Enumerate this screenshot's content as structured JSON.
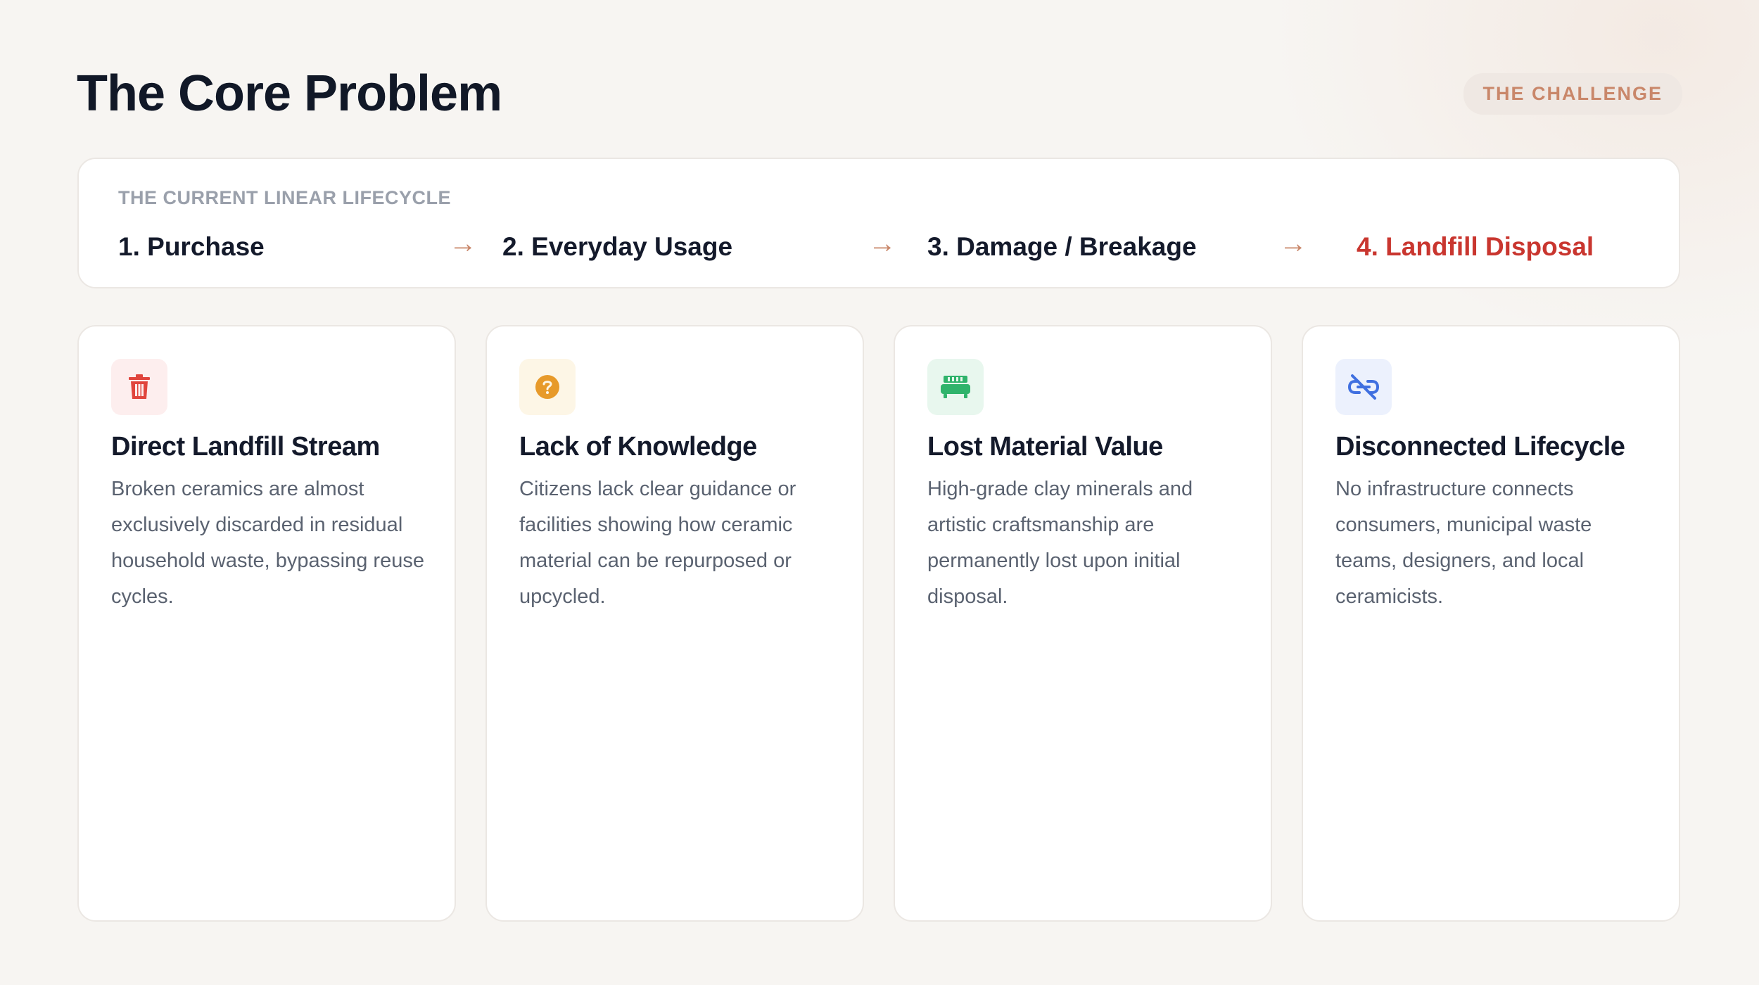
{
  "header": {
    "title": "The Core Problem",
    "badge": "THE CHALLENGE"
  },
  "lifecycle": {
    "label": "THE CURRENT LINEAR LIFECYCLE",
    "steps": [
      {
        "label": "1. Purchase"
      },
      {
        "label": "2. Everyday Usage"
      },
      {
        "label": "3. Damage / Breakage"
      },
      {
        "label": "4. Landfill Disposal"
      }
    ],
    "arrow": "→",
    "colors": {
      "accent": "#c9876a",
      "danger": "#c9362f"
    }
  },
  "cards": [
    {
      "icon": "trash-icon",
      "title": "Direct Landfill Stream",
      "text": "Broken ceramics are almost exclusively discarded in residual household waste, bypassing reuse cycles.",
      "icon_color": "#e0453d",
      "icon_bg": "#fdeeee"
    },
    {
      "icon": "question-circle-icon",
      "title": "Lack of Knowledge",
      "text": "Citizens lack clear guidance or facilities showing how ceramic material can be repurposed or upcycled.",
      "icon_color": "#e79a2a",
      "icon_bg": "#fdf6e6"
    },
    {
      "icon": "couch-icon",
      "title": "Lost Material Value",
      "text": "High-grade clay minerals and artistic craftsmanship are permanently lost upon initial disposal.",
      "icon_color": "#2fb36b",
      "icon_bg": "#e8f7ee"
    },
    {
      "icon": "broken-link-icon",
      "title": "Disconnected Lifecycle",
      "text": "No infrastructure connects consumers, municipal waste teams, designers, and local ceramicists.",
      "icon_color": "#3f6fe0",
      "icon_bg": "#ecf1fd"
    }
  ]
}
